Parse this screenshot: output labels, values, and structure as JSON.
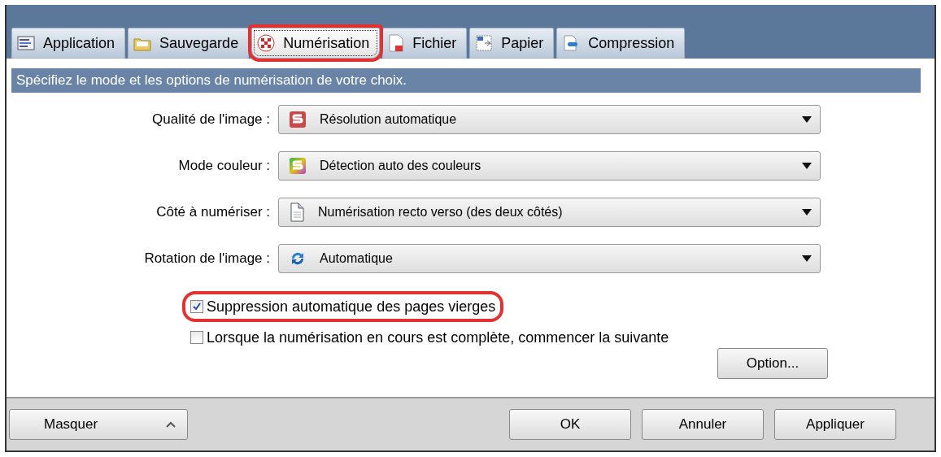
{
  "tabs": [
    {
      "label": "Application",
      "selected": false,
      "highlighted": false
    },
    {
      "label": "Sauvegarde",
      "selected": false,
      "highlighted": false
    },
    {
      "label": "Numérisation",
      "selected": true,
      "highlighted": true
    },
    {
      "label": "Fichier",
      "selected": false,
      "highlighted": false
    },
    {
      "label": "Papier",
      "selected": false,
      "highlighted": false
    },
    {
      "label": "Compression",
      "selected": false,
      "highlighted": false
    }
  ],
  "header": "Spécifiez le mode et les options de numérisation de votre choix.",
  "fields": [
    {
      "label": "Qualité de l'image :",
      "value": "Résolution automatique"
    },
    {
      "label": "Mode couleur :",
      "value": "Détection auto des couleurs"
    },
    {
      "label": "Côté à numériser :",
      "value": "Numérisation recto verso (des deux côtés)"
    },
    {
      "label": "Rotation de l'image :",
      "value": "Automatique"
    }
  ],
  "checkboxes": [
    {
      "label": "Suppression automatique des pages vierges",
      "checked": true,
      "highlighted": true
    },
    {
      "label": "Lorsque la numérisation en cours est complète, commencer la suivante",
      "checked": false,
      "highlighted": false
    }
  ],
  "option_button": "Option...",
  "footer": {
    "collapse_button": "Masquer",
    "buttons": [
      "OK",
      "Annuler",
      "Appliquer"
    ]
  }
}
